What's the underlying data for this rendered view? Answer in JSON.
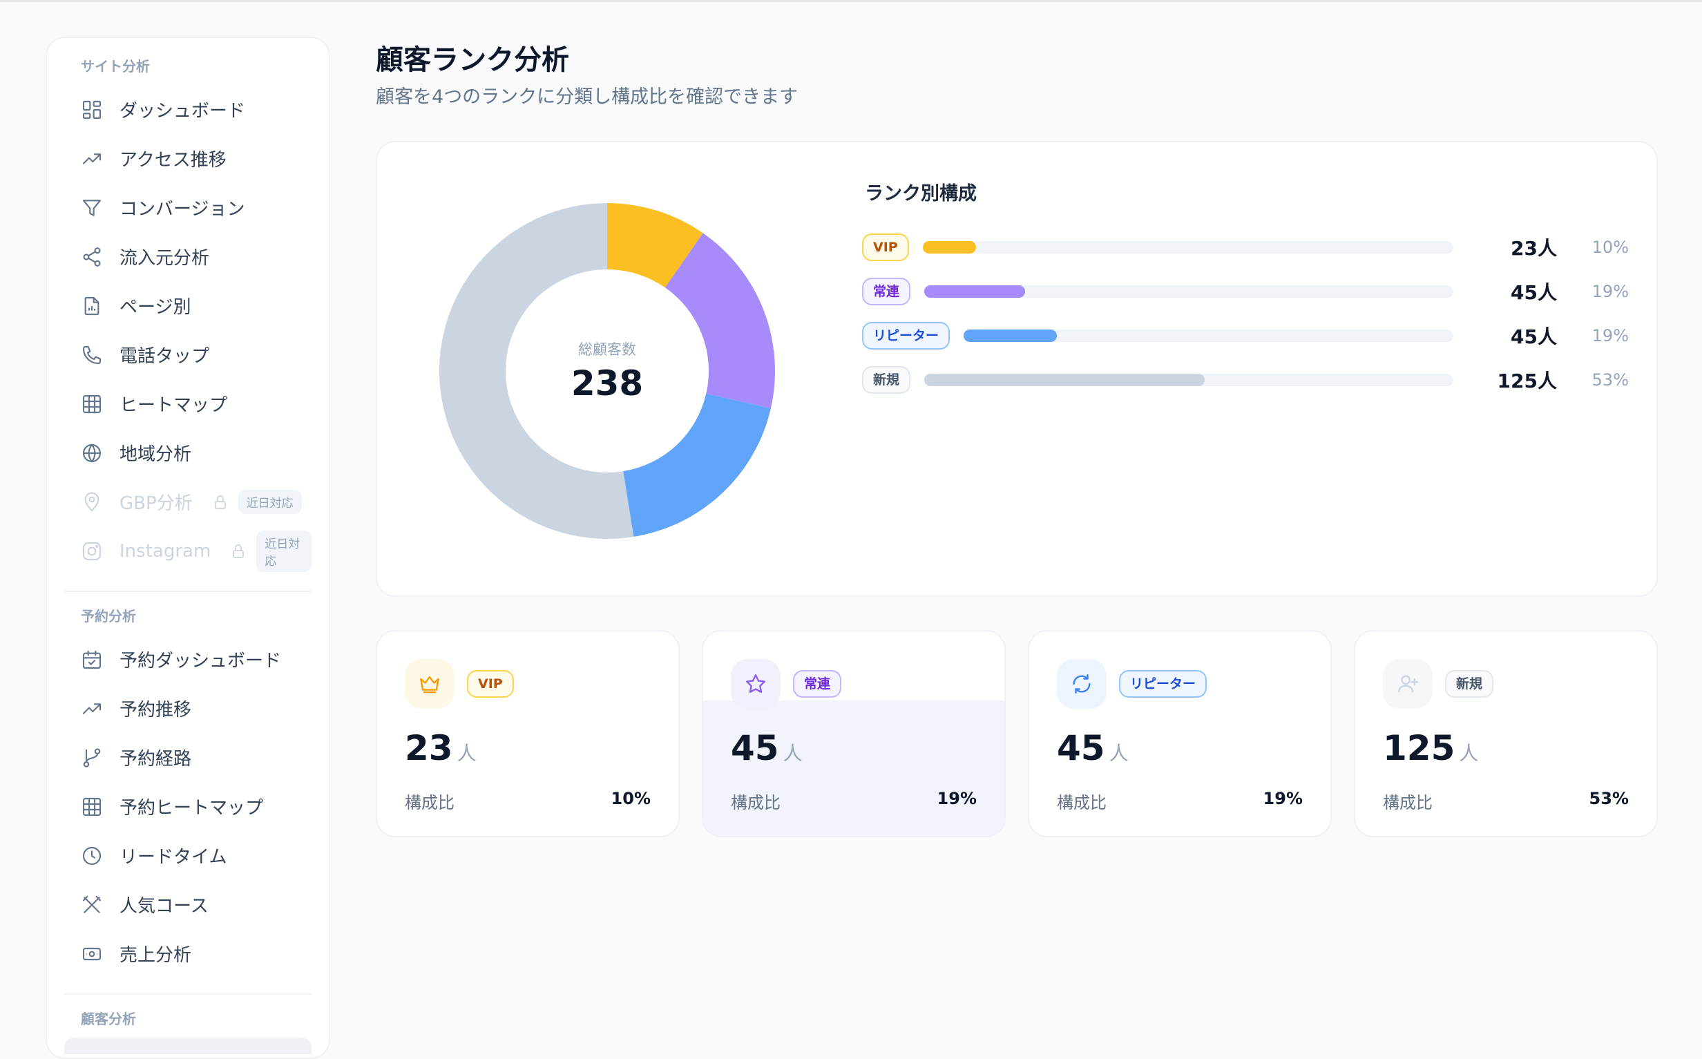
{
  "sidebar": {
    "sections": [
      {
        "label": "サイト分析",
        "items": [
          {
            "label": "ダッシュボード",
            "icon": "dashboard-icon"
          },
          {
            "label": "アクセス推移",
            "icon": "trending-up-icon"
          },
          {
            "label": "コンバージョン",
            "icon": "funnel-icon"
          },
          {
            "label": "流入元分析",
            "icon": "share-icon"
          },
          {
            "label": "ページ別",
            "icon": "document-chart-icon"
          },
          {
            "label": "電話タップ",
            "icon": "phone-icon"
          },
          {
            "label": "ヒートマップ",
            "icon": "grid-icon"
          },
          {
            "label": "地域分析",
            "icon": "globe-icon"
          },
          {
            "label": "GBP分析",
            "icon": "map-pin-icon",
            "disabled": true,
            "badge": "近日対応"
          },
          {
            "label": "Instagram",
            "icon": "instagram-icon",
            "disabled": true,
            "badge": "近日対応"
          }
        ]
      },
      {
        "label": "予約分析",
        "items": [
          {
            "label": "予約ダッシュボード",
            "icon": "calendar-check-icon"
          },
          {
            "label": "予約推移",
            "icon": "trending-up-icon"
          },
          {
            "label": "予約経路",
            "icon": "git-branch-icon"
          },
          {
            "label": "予約ヒートマップ",
            "icon": "grid-icon"
          },
          {
            "label": "リードタイム",
            "icon": "clock-icon"
          },
          {
            "label": "人気コース",
            "icon": "utensils-icon"
          },
          {
            "label": "売上分析",
            "icon": "banknote-icon"
          }
        ]
      },
      {
        "label": "顧客分析",
        "items": []
      }
    ]
  },
  "header": {
    "title": "顧客ランク分析",
    "subtitle": "顧客を4つのランクに分類し構成比を確認できます"
  },
  "donut": {
    "center_label": "総顧客数",
    "total": "238"
  },
  "composition": {
    "title": "ランク別構成"
  },
  "ranks": [
    {
      "key": "vip",
      "label": "VIP",
      "count": "23人",
      "count_num": "23",
      "unit": "人",
      "pct": "10%",
      "share_label": "構成比",
      "color": "#fbbf24",
      "icon": "crown-icon",
      "icon_bg": "#fef9e7",
      "icon_color": "#f59e0b"
    },
    {
      "key": "regular",
      "label": "常連",
      "count": "45人",
      "count_num": "45",
      "unit": "人",
      "pct": "19%",
      "share_label": "構成比",
      "color": "#a78bfa",
      "icon": "star-icon",
      "icon_bg": "#f1f0fb",
      "icon_color": "#8b5cf6"
    },
    {
      "key": "repeater",
      "label": "リピーター",
      "count": "45人",
      "count_num": "45",
      "unit": "人",
      "pct": "19%",
      "share_label": "構成比",
      "color": "#60a5fa",
      "icon": "refresh-icon",
      "icon_bg": "#eef4fd",
      "icon_color": "#3b82f6"
    },
    {
      "key": "new",
      "label": "新規",
      "count": "125人",
      "count_num": "125",
      "unit": "人",
      "pct": "53%",
      "share_label": "構成比",
      "color": "#cbd5e1",
      "icon": "user-plus-icon",
      "icon_bg": "#f6f7f9",
      "icon_color": "#cbd5e1"
    }
  ],
  "chart_data": {
    "type": "pie",
    "categories": [
      "VIP",
      "常連",
      "リピーター",
      "新規"
    ],
    "values": [
      23,
      45,
      45,
      125
    ],
    "percents": [
      10,
      19,
      19,
      53
    ],
    "colors": [
      "#fbbf24",
      "#a78bfa",
      "#60a5fa",
      "#cbd5e1"
    ],
    "center_label": "総顧客数",
    "total": 238
  }
}
